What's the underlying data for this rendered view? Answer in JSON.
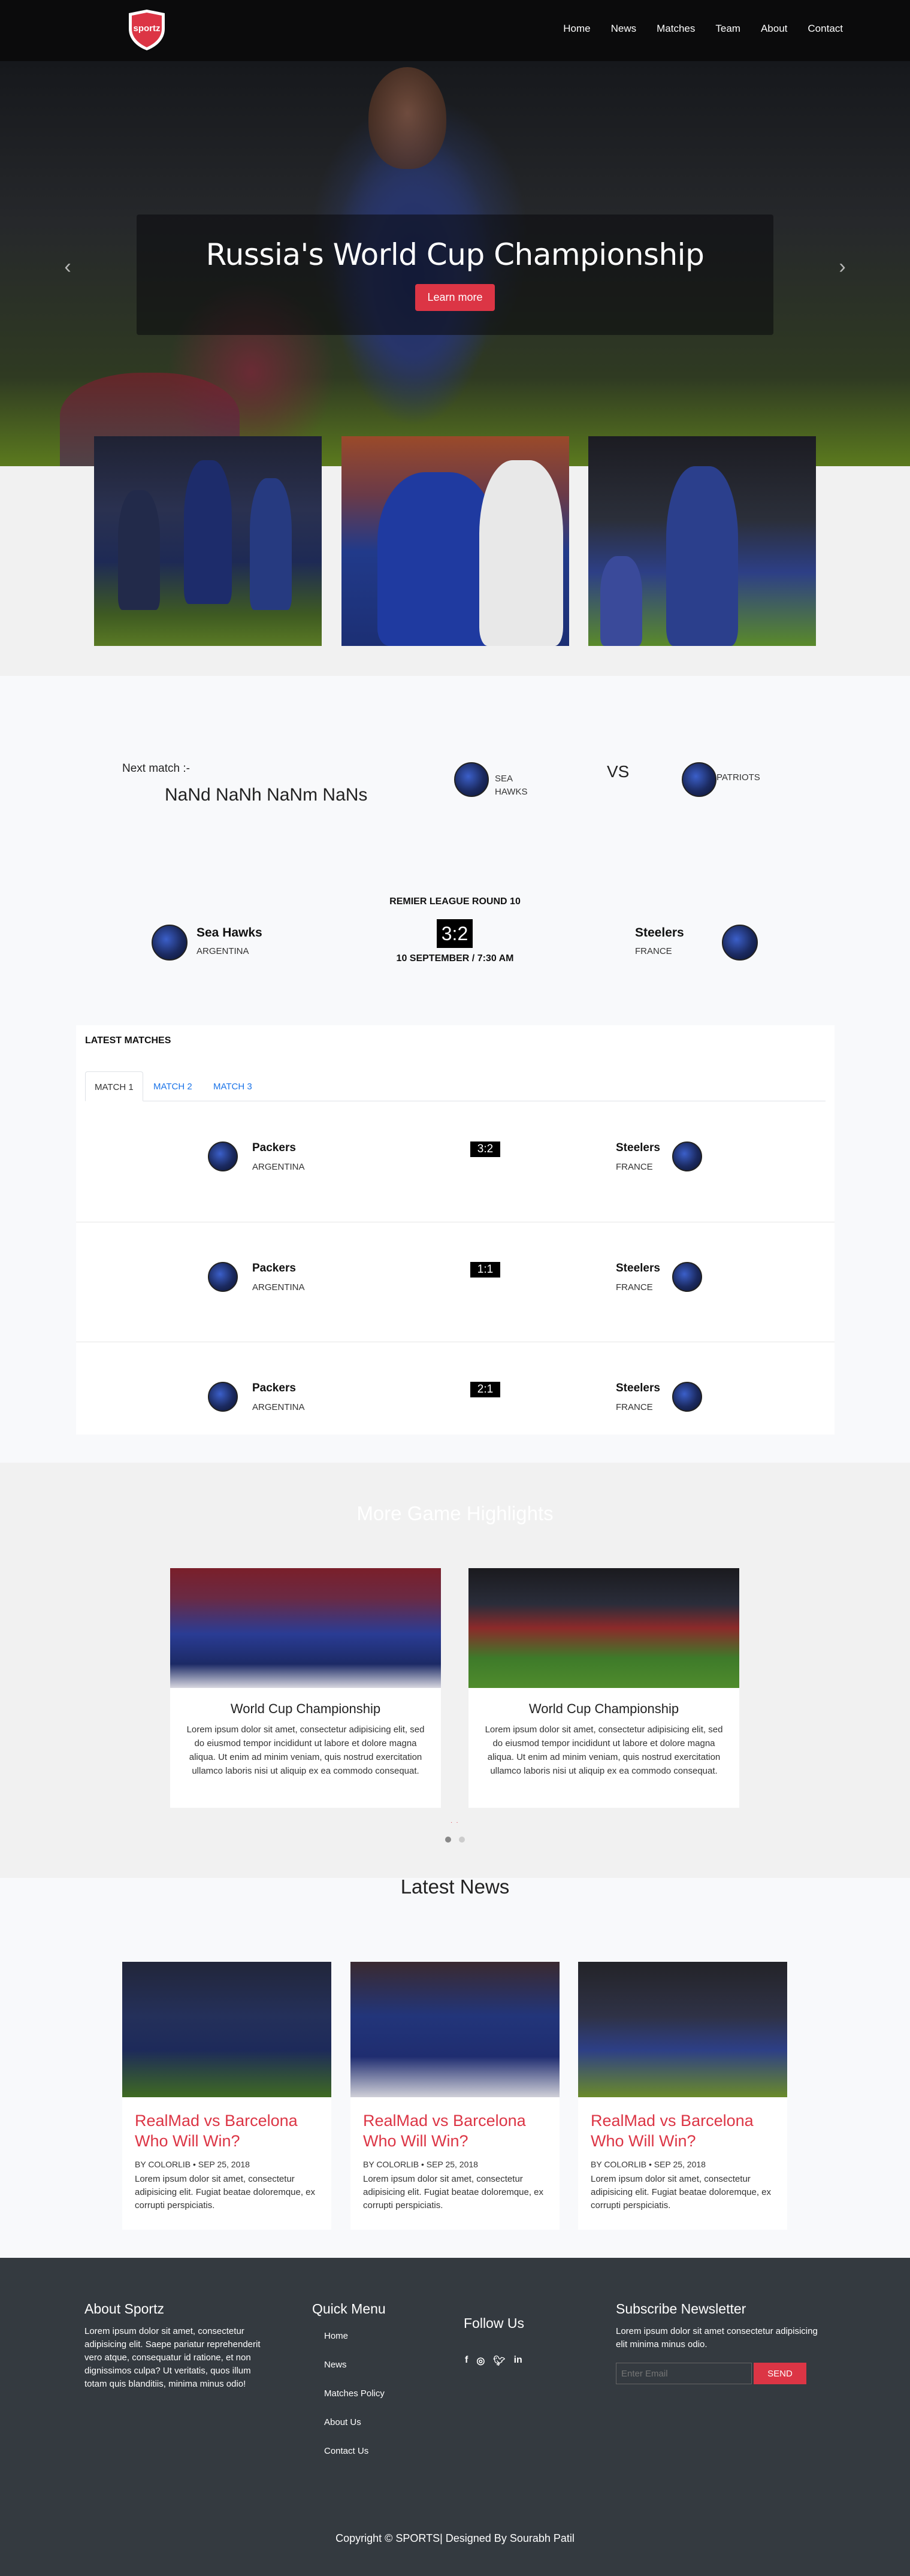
{
  "brand": {
    "logo_text": "sportz",
    "accent": "#dc3545"
  },
  "nav": {
    "items": [
      "Home",
      "News",
      "Matches",
      "Team",
      "About",
      "Contact"
    ]
  },
  "hero": {
    "title": "Russia's World Cup Championship",
    "button": "Learn more",
    "prev": "‹",
    "next": "›"
  },
  "next_match": {
    "label": "Next match :-",
    "date": "NaNd NaNh NaNm NaNs",
    "team1": "SEA HAWKS",
    "vs": "VS",
    "team2": "PATRIOTS"
  },
  "league": {
    "title": "REMIER LEAGUE ROUND 10",
    "team1": "Sea Hawks",
    "country1": "ARGENTINA",
    "score": "3:2",
    "date": "10 SEPTEMBER / 7:30 AM",
    "team2": "Steelers",
    "country2": "FRANCE"
  },
  "latest_matches": {
    "title": "LATEST MATCHES",
    "tabs": [
      "MATCH 1",
      "MATCH 2",
      "MATCH 3"
    ],
    "rows": [
      {
        "team1": "Packers",
        "country1": "ARGENTINA",
        "score": "3:2",
        "team2": "Steelers",
        "country2": "FRANCE"
      },
      {
        "team1": "Packers",
        "country1": "ARGENTINA",
        "score": "1:1",
        "team2": "Steelers",
        "country2": "FRANCE"
      },
      {
        "team1": "Packers",
        "country1": "ARGENTINA",
        "score": "2:1",
        "team2": "Steelers",
        "country2": "FRANCE"
      }
    ]
  },
  "highlights": {
    "title": "More Game Highlights",
    "cards": [
      {
        "title": "World Cup Championship",
        "text": "Lorem ipsum dolor sit amet, consectetur adipisicing elit, sed do eiusmod tempor incididunt ut labore et dolore magna aliqua. Ut enim ad minim veniam, quis nostrud exercitation ullamco laboris nisi ut aliquip ex ea commodo consequat."
      },
      {
        "title": "World Cup Championship",
        "text": "Lorem ipsum dolor sit amet, consectetur adipisicing elit, sed do eiusmod tempor incididunt ut labore et dolore magna aliqua. Ut enim ad minim veniam, quis nostrud exercitation ullamco laboris nisi ut aliquip ex ea commodo consequat."
      }
    ]
  },
  "news": {
    "title": "Latest News",
    "cards": [
      {
        "title": "RealMad vs Barcelona Who Will Win?",
        "meta": "BY COLORLIB • SEP 25, 2018",
        "text": "Lorem ipsum dolor sit amet, consectetur adipisicing elit. Fugiat beatae doloremque, ex corrupti perspiciatis."
      },
      {
        "title": "RealMad vs Barcelona Who Will Win?",
        "meta": "BY COLORLIB • SEP 25, 2018",
        "text": "Lorem ipsum dolor sit amet, consectetur adipisicing elit. Fugiat beatae doloremque, ex corrupti perspiciatis."
      },
      {
        "title": "RealMad vs Barcelona Who Will Win?",
        "meta": "BY COLORLIB • SEP 25, 2018",
        "text": "Lorem ipsum dolor sit amet, consectetur adipisicing elit. Fugiat beatae doloremque, ex corrupti perspiciatis."
      }
    ]
  },
  "footer": {
    "about_title": "About Sportz",
    "about_text": "Lorem ipsum dolor sit amet, consectetur adipisicing elit. Saepe pariatur reprehenderit vero atque, consequatur id ratione, et non dignissimos culpa? Ut veritatis, quos illum totam quis blanditiis, minima minus odio!",
    "menu_title": "Quick Menu",
    "menu": [
      "Home",
      "News",
      "Matches Policy",
      "About Us",
      "Contact Us"
    ],
    "follow_title": "Follow Us",
    "social": [
      "facebook-icon",
      "instagram-icon",
      "twitter-icon",
      "linkedin-icon"
    ],
    "newsletter_title": "Subscribe Newsletter",
    "newsletter_text": "Lorem ipsum dolor sit amet consectetur adipisicing elit minima minus odio.",
    "email_placeholder": "Enter Email",
    "send": "SEND",
    "copyright": "Copyright © SPORTS| Designed By Sourabh Patil"
  }
}
